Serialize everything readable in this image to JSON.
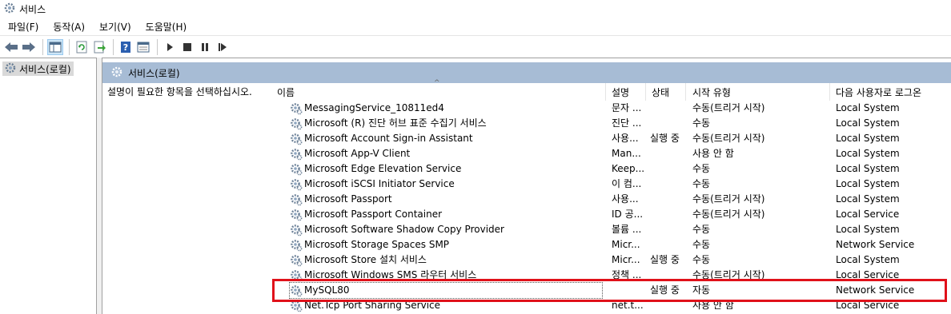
{
  "window": {
    "title": "서비스"
  },
  "menu": [
    "파일(F)",
    "동작(A)",
    "보기(V)",
    "도움말(H)"
  ],
  "toolbar": {
    "buttons": [
      "back-icon",
      "forward-icon",
      "show-hide-console-tree-icon",
      "refresh-icon",
      "export-list-icon",
      "help-icon",
      "properties-icon",
      "start-service-icon",
      "stop-service-icon",
      "pause-service-icon",
      "restart-service-icon"
    ]
  },
  "tree": {
    "root_label": "서비스(로컬)"
  },
  "panel": {
    "header": "서비스(로컬)",
    "description": "설명이 필요한 항목을 선택하십시오."
  },
  "columns": {
    "name": "이름",
    "description": "설명",
    "status": "상태",
    "startup": "시작 유형",
    "logon": "다음 사용자로 로그온"
  },
  "services": [
    {
      "name": "MessagingService_10811ed4",
      "description": "문자 ...",
      "status": "",
      "startup": "수동(트리거 시작)",
      "logon": "Local System"
    },
    {
      "name": "Microsoft (R) 진단 허브 표준 수집기 서비스",
      "description": "진단 ...",
      "status": "",
      "startup": "수동",
      "logon": "Local System"
    },
    {
      "name": "Microsoft Account Sign-in Assistant",
      "description": "사용...",
      "status": "실행 중",
      "startup": "수동(트리거 시작)",
      "logon": "Local System"
    },
    {
      "name": "Microsoft App-V Client",
      "description": "Man...",
      "status": "",
      "startup": "사용 안 함",
      "logon": "Local System"
    },
    {
      "name": "Microsoft Edge Elevation Service",
      "description": "Keep...",
      "status": "",
      "startup": "수동",
      "logon": "Local System"
    },
    {
      "name": "Microsoft iSCSI Initiator Service",
      "description": "이 컴...",
      "status": "",
      "startup": "수동",
      "logon": "Local System"
    },
    {
      "name": "Microsoft Passport",
      "description": "사용...",
      "status": "",
      "startup": "수동(트리거 시작)",
      "logon": "Local System"
    },
    {
      "name": "Microsoft Passport Container",
      "description": "ID 공...",
      "status": "",
      "startup": "수동(트리거 시작)",
      "logon": "Local Service"
    },
    {
      "name": "Microsoft Software Shadow Copy Provider",
      "description": "볼륨 ...",
      "status": "",
      "startup": "수동",
      "logon": "Local System"
    },
    {
      "name": "Microsoft Storage Spaces SMP",
      "description": "Micr...",
      "status": "",
      "startup": "수동",
      "logon": "Network Service"
    },
    {
      "name": "Microsoft Store 설치 서비스",
      "description": "Micr...",
      "status": "실행 중",
      "startup": "수동",
      "logon": "Local System"
    },
    {
      "name": "Microsoft Windows SMS 라우터 서비스",
      "description": "정책 ...",
      "status": "",
      "startup": "수동(트리거 시작)",
      "logon": "Local Service"
    },
    {
      "name": "MySQL80",
      "description": "",
      "status": "실행 중",
      "startup": "자동",
      "logon": "Network Service"
    },
    {
      "name": "Net.Tcp Port Sharing Service",
      "description": "net.t...",
      "status": "",
      "startup": "사용 안 함",
      "logon": "Local Service"
    }
  ],
  "colors": {
    "panel_header_bg": "#a7bcd5",
    "highlight_border": "#e0111a",
    "tree_selected_bg": "#d9d9d9"
  }
}
